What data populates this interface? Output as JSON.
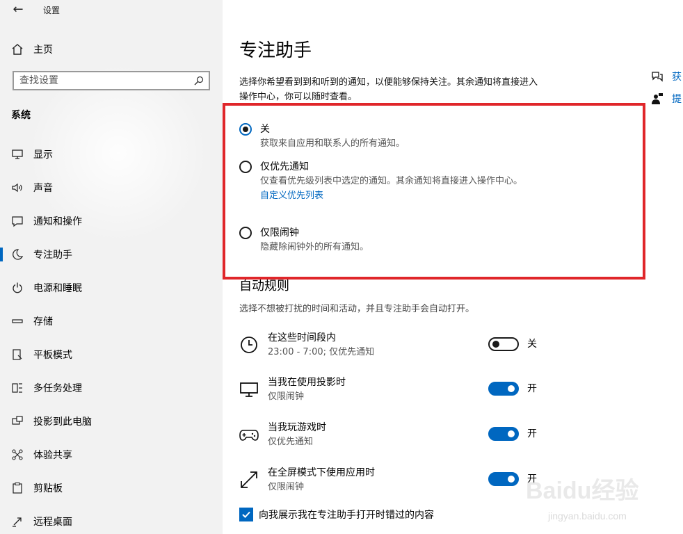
{
  "window": {
    "title": "设置",
    "back_icon": "back-arrow-icon"
  },
  "sidebar": {
    "home_label": "主页",
    "search_placeholder": "查找设置",
    "section_title": "系统",
    "items": [
      {
        "label": "显示",
        "icon": "display-icon"
      },
      {
        "label": "声音",
        "icon": "speaker-icon"
      },
      {
        "label": "通知和操作",
        "icon": "notification-icon"
      },
      {
        "label": "专注助手",
        "icon": "moon-icon",
        "active": true
      },
      {
        "label": "电源和睡眠",
        "icon": "power-icon"
      },
      {
        "label": "存储",
        "icon": "storage-icon"
      },
      {
        "label": "平板模式",
        "icon": "tablet-icon"
      },
      {
        "label": "多任务处理",
        "icon": "multitask-icon"
      },
      {
        "label": "投影到此电脑",
        "icon": "project-icon"
      },
      {
        "label": "体验共享",
        "icon": "share-icon"
      },
      {
        "label": "剪贴板",
        "icon": "clipboard-icon"
      },
      {
        "label": "远程桌面",
        "icon": "remote-desktop-icon"
      }
    ]
  },
  "main": {
    "title": "专注助手",
    "description": "选择你希望看到到和听到的通知，以便能够保持关注。其余通知将直接进入操作中心，你可以随时查看。",
    "options": [
      {
        "label": "关",
        "desc": "获取来自应用和联系人的所有通知。",
        "checked": true
      },
      {
        "label": "仅优先通知",
        "desc": "仅查看优先级列表中选定的通知。其余通知将直接进入操作中心。",
        "link": "自定义优先列表",
        "checked": false
      },
      {
        "label": "仅限闹钟",
        "desc": "隐藏除闹钟外的所有通知。",
        "checked": false
      }
    ],
    "auto_rules": {
      "title": "自动规则",
      "desc": "选择不想被打扰的时间和活动，并且专注助手会自动打开。",
      "rules": [
        {
          "title": "在这些时间段内",
          "sub": "23:00 - 7:00; 仅优先通知",
          "state": "关",
          "on": false,
          "icon": "clock-icon"
        },
        {
          "title": "当我在使用投影时",
          "sub": "仅限闹钟",
          "state": "开",
          "on": true,
          "icon": "monitor-icon"
        },
        {
          "title": "当我玩游戏时",
          "sub": "仅优先通知",
          "state": "开",
          "on": true,
          "icon": "gamepad-icon"
        },
        {
          "title": "在全屏模式下使用应用时",
          "sub": "仅限闹钟",
          "state": "开",
          "on": true,
          "icon": "fullscreen-icon"
        }
      ],
      "checkbox_label": "向我展示我在专注助手打开时错过的内容",
      "checkbox_checked": true
    }
  },
  "related": [
    {
      "label": "获",
      "icon": "help-chat-icon"
    },
    {
      "label": "提",
      "icon": "feedback-person-icon"
    }
  ],
  "watermark": {
    "brand": "Baidu经验",
    "url": "jingyan.baidu.com"
  },
  "colors": {
    "accent": "#0067c0",
    "highlight": "#e0262a",
    "sidebar_bg": "#f2f2f2"
  }
}
